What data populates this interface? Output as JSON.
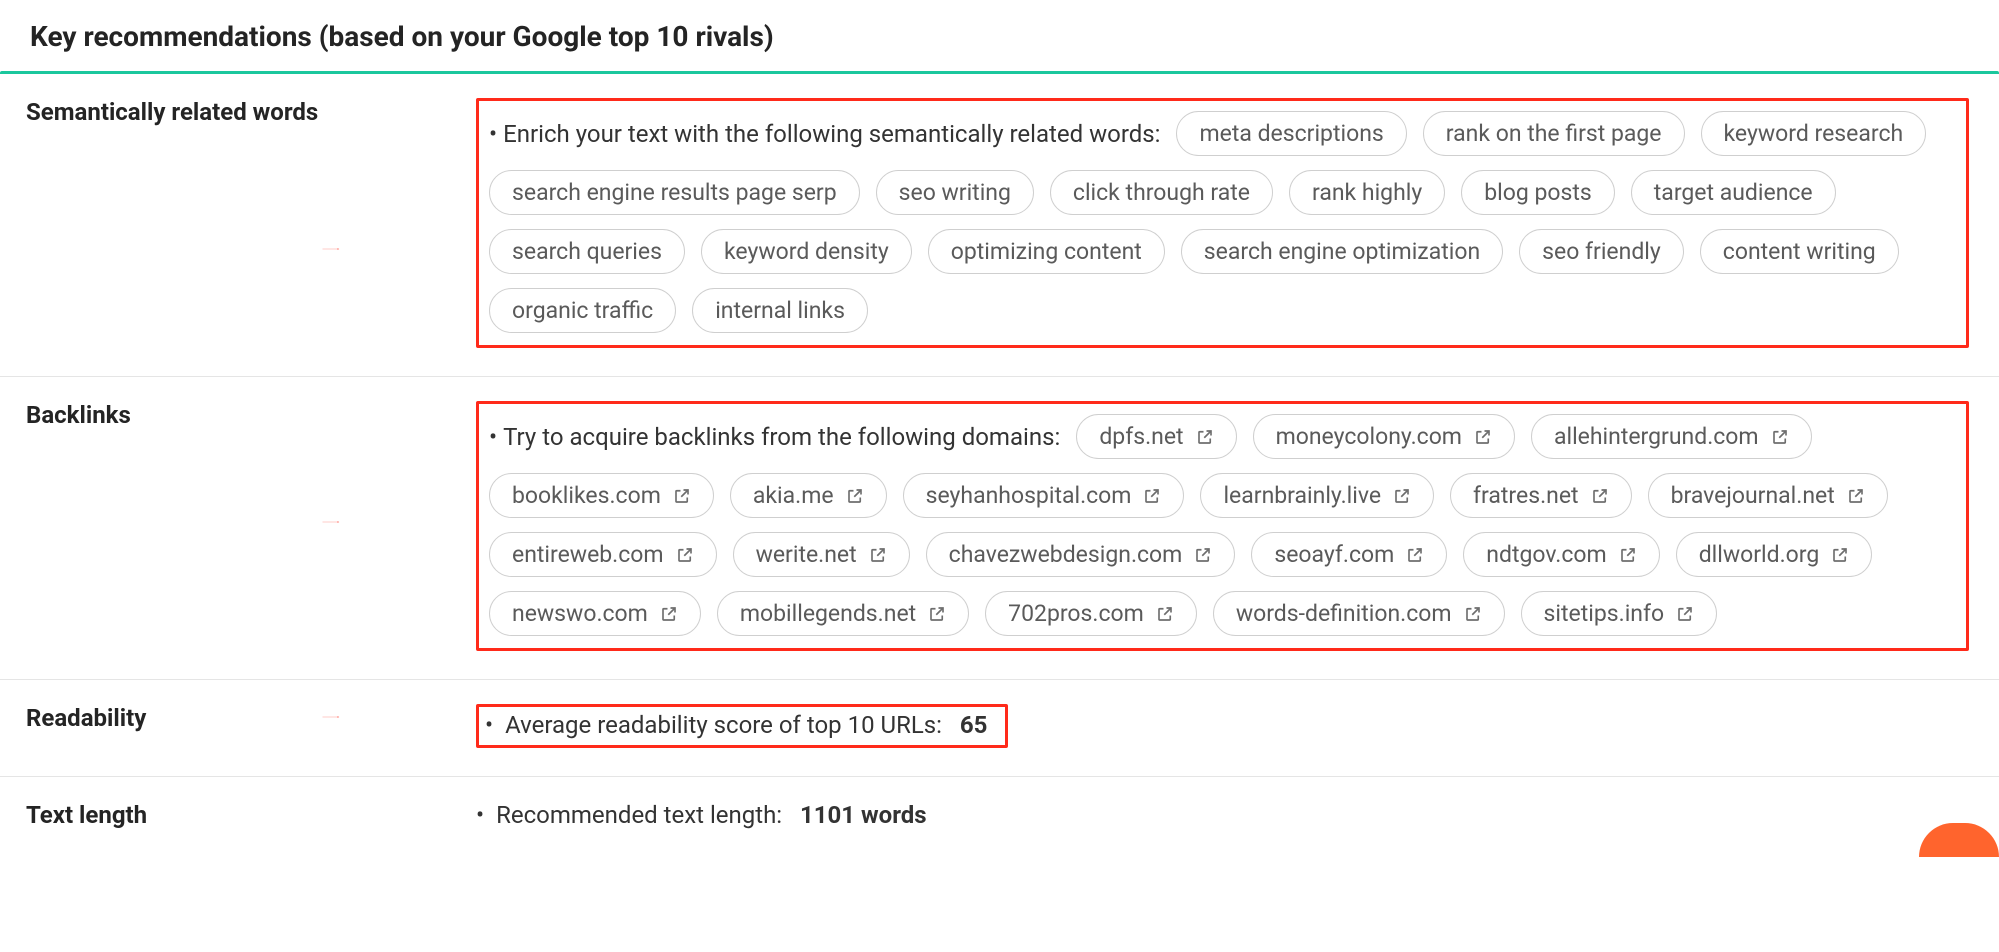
{
  "header": {
    "title": "Key recommendations (based on your Google top 10 rivals)"
  },
  "sections": {
    "semantics": {
      "label": "Semantically related words",
      "lead": "Enrich your text with the following semantically related words:",
      "chips": [
        "meta descriptions",
        "rank on the first page",
        "keyword research",
        "search engine results page serp",
        "seo writing",
        "click through rate",
        "rank highly",
        "blog posts",
        "target audience",
        "search queries",
        "keyword density",
        "optimizing content",
        "search engine optimization",
        "seo friendly",
        "content writing",
        "organic traffic",
        "internal links"
      ]
    },
    "backlinks": {
      "label": "Backlinks",
      "lead": "Try to acquire backlinks from the following domains:",
      "chips": [
        "dpfs.net",
        "moneycolony.com",
        "allehintergrund.com",
        "booklikes.com",
        "akia.me",
        "seyhanhospital.com",
        "learnbrainly.live",
        "fratres.net",
        "bravejournal.net",
        "entireweb.com",
        "werite.net",
        "chavezwebdesign.com",
        "seoayf.com",
        "ndtgov.com",
        "dllworld.org",
        "newswo.com",
        "mobillegends.net",
        "702pros.com",
        "words-definition.com",
        "sitetips.info"
      ]
    },
    "readability": {
      "label": "Readability",
      "lead": "Average readability score of top 10 URLs:",
      "value": "65"
    },
    "textlength": {
      "label": "Text length",
      "lead": "Recommended text length:",
      "value": "1101 words"
    }
  }
}
